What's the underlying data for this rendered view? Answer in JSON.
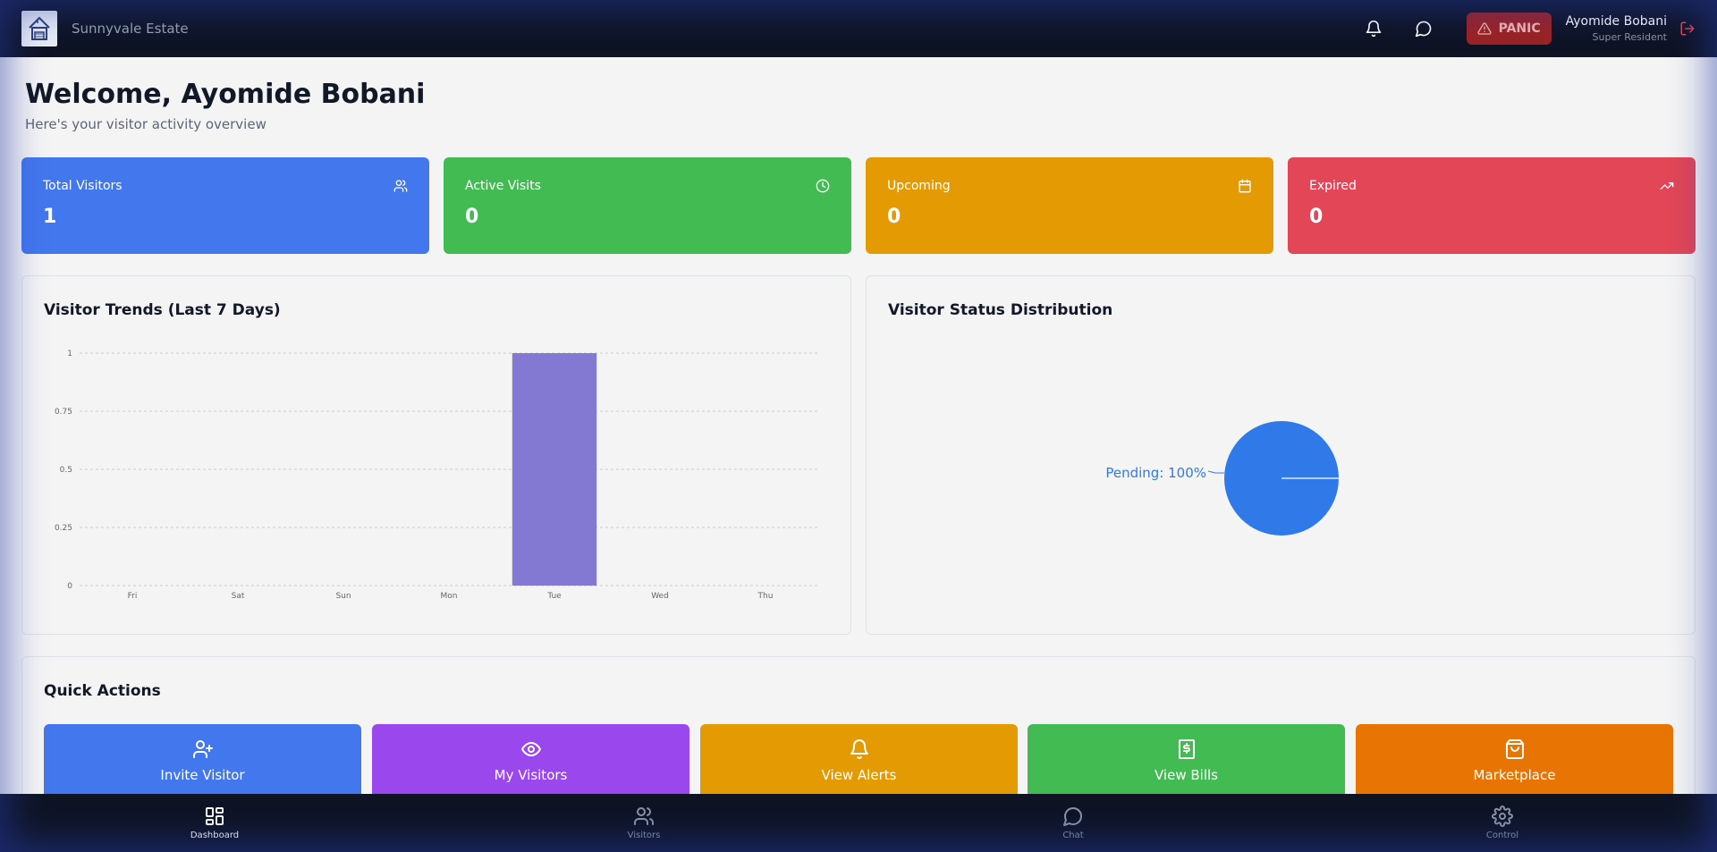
{
  "header": {
    "estate_name": "Sunnyvale Estate",
    "panic_label": "PANIC",
    "user_name": "Ayomide Bobani",
    "user_role": "Super Resident"
  },
  "welcome": {
    "title": "Welcome, Ayomide Bobani",
    "subtitle": "Here's your visitor activity overview"
  },
  "stats": [
    {
      "label": "Total Visitors",
      "value": "1",
      "icon": "users-icon",
      "color": "#4377ee"
    },
    {
      "label": "Active Visits",
      "value": "0",
      "icon": "clock-icon",
      "color": "#43bb53"
    },
    {
      "label": "Upcoming",
      "value": "0",
      "icon": "calendar-icon",
      "color": "#e49a03"
    },
    {
      "label": "Expired",
      "value": "0",
      "icon": "trending-up-icon",
      "color": "#e24657"
    }
  ],
  "trends": {
    "title": "Visitor Trends (Last 7 Days)"
  },
  "distribution": {
    "title": "Visitor Status Distribution"
  },
  "chart_data": [
    {
      "type": "bar",
      "title": "Visitor Trends (Last 7 Days)",
      "categories": [
        "Fri",
        "Sat",
        "Sun",
        "Mon",
        "Tue",
        "Wed",
        "Thu"
      ],
      "values": [
        0,
        0,
        0,
        0,
        1,
        0,
        0
      ],
      "yticks": [
        "0",
        "0.25",
        "0.5",
        "0.75",
        "1"
      ],
      "ylim": [
        0,
        1
      ],
      "grid": true,
      "bar_color": "#8479d2"
    },
    {
      "type": "pie",
      "title": "Visitor Status Distribution",
      "slices": [
        {
          "label": "Pending",
          "value": 100,
          "color": "#2f7ae8"
        }
      ],
      "slice_label": "Pending: 100%"
    }
  ],
  "quick_actions": {
    "title": "Quick Actions",
    "items": [
      {
        "label": "Invite Visitor",
        "icon": "user-plus-icon",
        "color": "#4377ee"
      },
      {
        "label": "My Visitors",
        "icon": "eye-icon",
        "color": "#9b47ee"
      },
      {
        "label": "View Alerts",
        "icon": "bell-icon",
        "color": "#e49a03"
      },
      {
        "label": "View Bills",
        "icon": "receipt-icon",
        "color": "#43bb53"
      },
      {
        "label": "Marketplace",
        "icon": "shopping-bag-icon",
        "color": "#e87503"
      }
    ]
  },
  "bottom_nav": [
    {
      "label": "Dashboard",
      "icon": "dashboard-icon",
      "active": true
    },
    {
      "label": "Visitors",
      "icon": "users-icon",
      "active": false
    },
    {
      "label": "Chat",
      "icon": "chat-icon",
      "active": false
    },
    {
      "label": "Control",
      "icon": "gear-icon",
      "active": false
    }
  ]
}
